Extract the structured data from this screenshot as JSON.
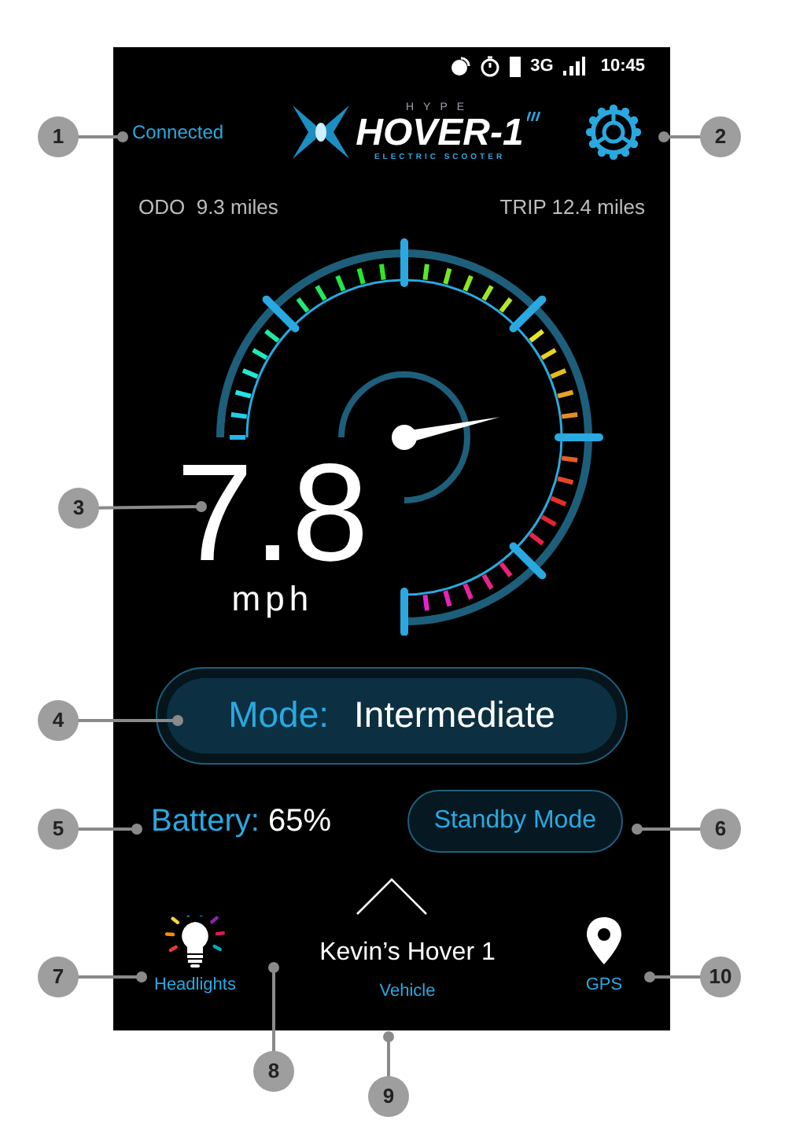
{
  "status_bar": {
    "network": "3G",
    "time": "10:45"
  },
  "header": {
    "connection": "Connected",
    "logo": {
      "brand": "HYPE",
      "name": "HOVER-1",
      "tagline": "ELECTRIC SCOOTER"
    }
  },
  "trip_info": {
    "odo": "ODO  9.3 miles",
    "trip": "TRIP 12.4 miles"
  },
  "speed": {
    "value": "7.8",
    "unit": "mph"
  },
  "mode": {
    "label": "Mode:",
    "value": "Intermediate"
  },
  "battery": {
    "label": "Battery:",
    "value": "65%"
  },
  "standby_button": "Standby Mode",
  "bottom_nav": [
    {
      "kind": "headlights",
      "label": "Headlights"
    },
    {
      "kind": "vehicle",
      "title": "Kevin’s Hover 1",
      "label": "Vehicle"
    },
    {
      "kind": "gps",
      "label": "GPS"
    }
  ],
  "callouts": [
    "1",
    "2",
    "3",
    "4",
    "5",
    "6",
    "7",
    "8",
    "9",
    "10"
  ]
}
